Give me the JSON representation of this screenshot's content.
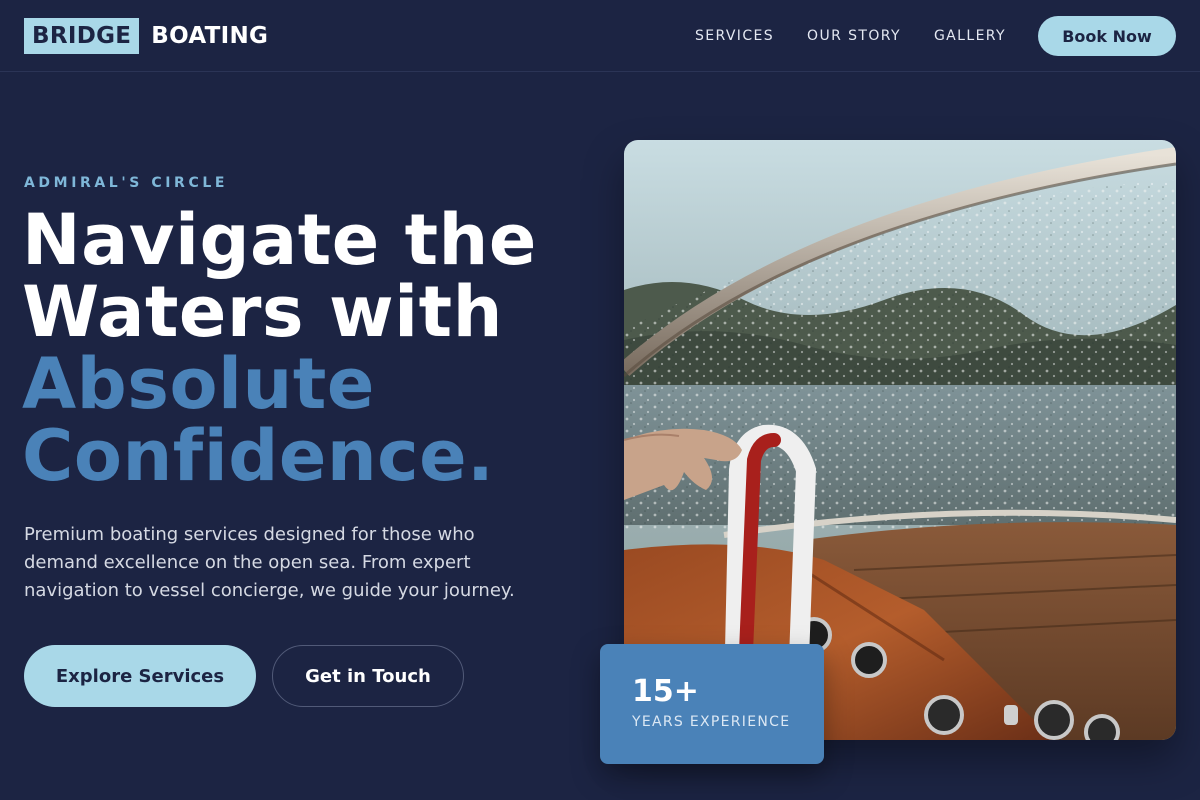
{
  "brand": {
    "logo_box_text": "BRIDGE",
    "logo_text": "BOATING",
    "colors": {
      "navy": "#1c2443",
      "light_blue": "#a9d8e8",
      "accent_blue": "#4a82b8"
    }
  },
  "nav": {
    "links": [
      "SERVICES",
      "OUR STORY",
      "GALLERY"
    ],
    "cta_label": "Book Now"
  },
  "hero": {
    "eyebrow": "ADMIRAL'S CIRCLE",
    "headline_line1": "Navigate the",
    "headline_line2": "Waters with",
    "headline_accent_line1": "Absolute",
    "headline_accent_line2": "Confidence.",
    "description": "Premium boating services designed for those who demand excellence on the open sea. From expert navigation to vessel concierge, we guide your journey.",
    "primary_button": "Explore Services",
    "secondary_button": "Get in Touch"
  },
  "stat": {
    "value": "15+",
    "label": "YEARS EXPERIENCE"
  }
}
